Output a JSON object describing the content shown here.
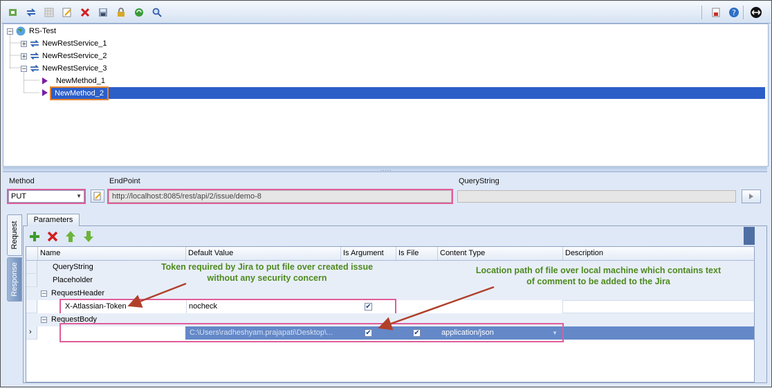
{
  "toolbar": {
    "left_icons": [
      "new-project-icon",
      "refresh-icon",
      "grid-icon",
      "edit-icon",
      "delete-icon",
      "save-icon",
      "lock-icon",
      "sync-icon",
      "search-icon"
    ],
    "right_icons": [
      "report-icon",
      "help-icon",
      "exit-icon"
    ]
  },
  "tree": {
    "root": "RS-Test",
    "services": [
      "NewRestService_1",
      "NewRestService_2",
      "NewRestService_3"
    ],
    "methods": [
      "NewMethod_1",
      "NewMethod_2"
    ],
    "selected": "NewMethod_2"
  },
  "request": {
    "method_label": "Method",
    "method_value": "PUT",
    "endpoint_label": "EndPoint",
    "endpoint_value": "http://localhost:8085/rest/api/2/issue/demo-8",
    "querystring_label": "QueryString",
    "querystring_value": ""
  },
  "side_tabs": {
    "request": "Request",
    "response": "Response"
  },
  "params": {
    "tab_label": "Parameters",
    "columns": [
      "Name",
      "Default Value",
      "Is Argument",
      "Is File",
      "Content Type",
      "Description"
    ],
    "rows": [
      {
        "name": "QueryString",
        "value": "",
        "is_argument": false,
        "is_file": false,
        "content_type": "",
        "description": ""
      },
      {
        "name": "Placeholder",
        "value": "",
        "is_argument": false,
        "is_file": false,
        "content_type": "",
        "description": ""
      },
      {
        "name": "RequestHeader",
        "value": "",
        "group": true
      },
      {
        "name": "X-Atlassian-Token",
        "value": "nocheck",
        "is_argument": true,
        "is_file": false,
        "content_type": "",
        "description": ""
      },
      {
        "name": "RequestBody",
        "value": "",
        "group": true
      },
      {
        "name": "",
        "value": "C:\\Users\\radheshyam.prajapati\\Desktop\\...",
        "is_argument": true,
        "is_file": true,
        "content_type": "application/json",
        "description": ""
      }
    ]
  },
  "annotations": {
    "token_note": "Token required by Jira to put file over created issue without any security concern",
    "file_note": "Location path of file over local machine which contains text of comment to be added to the Jira"
  },
  "colors": {
    "selection": "#2c5ec8",
    "highlight_orange": "#e7842c",
    "highlight_pink": "#e05d9a",
    "annotation_green": "#4d8a1e",
    "arrow": "#b0402a"
  }
}
